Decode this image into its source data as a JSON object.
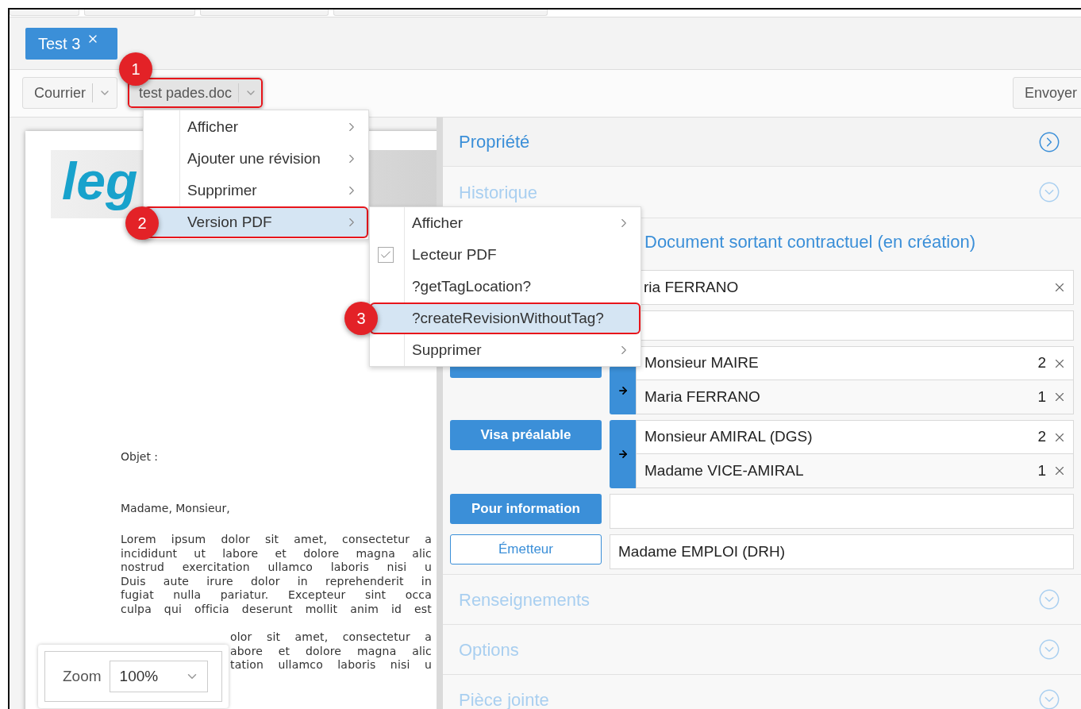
{
  "tabs": [
    {
      "label": "Test 3",
      "selected": true
    }
  ],
  "toolbar": {
    "buttons": [
      {
        "label": "Courrier",
        "pressed": false
      },
      {
        "label": "test pades.doc",
        "pressed": true,
        "callout": "1"
      }
    ],
    "send": "Envoyer"
  },
  "document": {
    "logo": "leg",
    "subject": "Objet :",
    "salutation": "Madame, Monsieur,",
    "paragraph_1": [
      "Lorem ipsum dolor sit amet, consectetur a",
      "incididunt ut labore et dolore magna alic",
      "nostrud exercitation ullamco laboris nisi u",
      "Duis aute irure dolor in reprehenderit in",
      "fugiat nulla pariatur. Excepteur sint occa",
      "culpa qui officia deserunt mollit anim id est"
    ],
    "paragraph_2": [
      "olor sit amet, consectetur a",
      "abore et dolore magna alic",
      "tation ullamco laboris nisi u"
    ]
  },
  "zoom": {
    "label": "Zoom",
    "value": "100%"
  },
  "panel": {
    "top_sections": [
      {
        "title": "Propriété",
        "active": true
      },
      {
        "title": "Historique",
        "active": false
      }
    ],
    "document_section": {
      "title": "Document sortant contractuel (en création)",
      "fields": [
        {
          "value": "ria FERRANO",
          "removable": true
        },
        {
          "removable": false
        }
      ],
      "rows": [
        {
          "kind": "group",
          "entries": [
            {
              "name": "Monsieur MAIRE",
              "order": "2"
            },
            {
              "name": "Maria FERRANO",
              "order": "1"
            }
          ]
        },
        {
          "kind": "group",
          "role": "Visa préalable",
          "role_filled": true,
          "entries": [
            {
              "name": "Monsieur AMIRAL (DGS)",
              "order": "2"
            },
            {
              "name": "Madame VICE-AMIRAL",
              "order": "1"
            }
          ]
        },
        {
          "kind": "single",
          "role": "Pour information",
          "role_filled": true
        },
        {
          "kind": "single",
          "role": "Émetteur",
          "role_filled": false,
          "value": "Madame EMPLOI (DRH)"
        }
      ]
    },
    "bottom_sections": [
      {
        "title": "Renseignements",
        "active": false
      },
      {
        "title": "Options",
        "active": false
      },
      {
        "title": "Pièce jointe",
        "active": false
      }
    ]
  },
  "menu": {
    "items": [
      {
        "label": "Afficher",
        "selected": false
      },
      {
        "label": "Ajouter une révision",
        "selected": false
      },
      {
        "label": "Supprimer",
        "selected": false
      },
      {
        "label": "Version PDF",
        "selected": true,
        "callout": "2"
      }
    ]
  },
  "submenu": {
    "items": [
      {
        "label": "Afficher",
        "kind": "submenu",
        "selected": false
      },
      {
        "label": "Lecteur PDF",
        "kind": "check",
        "checked": true,
        "selected": false
      },
      {
        "label": "?getTagLocation?",
        "kind": "action",
        "selected": false
      },
      {
        "label": "?createRevisionWithoutTag?",
        "kind": "action",
        "selected": true,
        "callout": "3"
      },
      {
        "label": "Supprimer",
        "kind": "submenu",
        "selected": false
      }
    ]
  }
}
